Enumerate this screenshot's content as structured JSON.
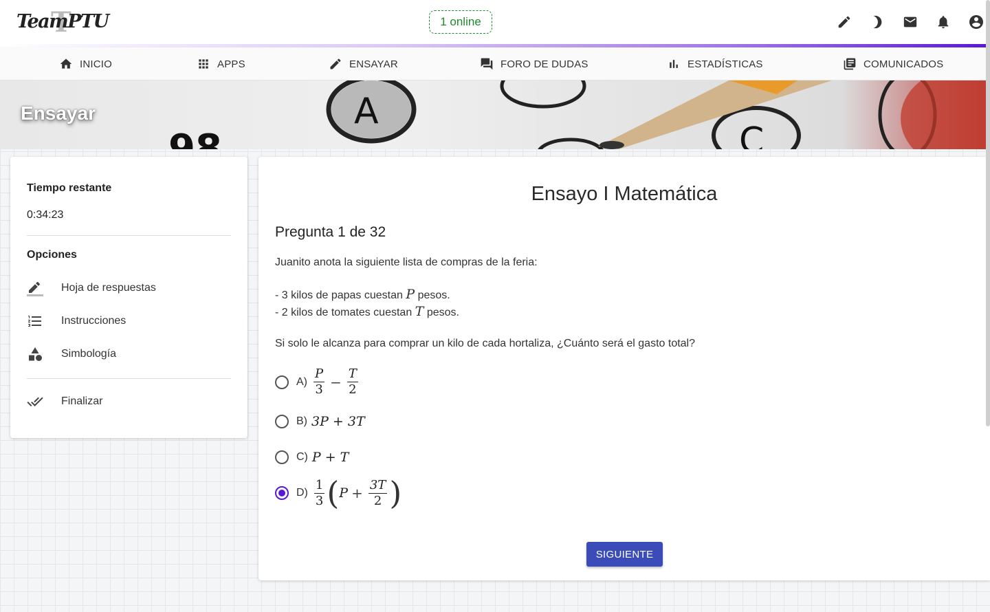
{
  "header": {
    "logo_text": "TeamPTU",
    "online_label": "1 online",
    "icons": [
      "pencil-icon",
      "moon-icon",
      "mail-icon",
      "bell-icon",
      "account-icon"
    ]
  },
  "nav": {
    "items": [
      {
        "label": "INICIO",
        "icon": "home-icon"
      },
      {
        "label": "APPS",
        "icon": "apps-grid-icon"
      },
      {
        "label": "ENSAYAR",
        "icon": "pencil-icon"
      },
      {
        "label": "FORO DE DUDAS",
        "icon": "forum-icon"
      },
      {
        "label": "ESTADÍSTICAS",
        "icon": "bar-chart-icon"
      },
      {
        "label": "COMUNICADOS",
        "icon": "library-icon"
      }
    ]
  },
  "banner": {
    "title": "Ensayar"
  },
  "sidebar": {
    "time_label": "Tiempo restante",
    "time_value": "0:34:23",
    "options_label": "Opciones",
    "items": [
      {
        "label": "Hoja de respuestas",
        "icon": "edit-sheet-icon"
      },
      {
        "label": "Instrucciones",
        "icon": "numbered-list-icon"
      },
      {
        "label": "Simbología",
        "icon": "shapes-icon"
      }
    ],
    "finish_label": "Finalizar",
    "finish_icon": "double-check-icon"
  },
  "exam": {
    "title": "Ensayo I Matemática",
    "question_heading": "Pregunta 1 de 32",
    "intro": "Juanito anota la siguiente lista de compras de la feria:",
    "line1_prefix": "- 3 kilos de papas cuestan",
    "line1_var": "P",
    "line1_suffix": "pesos.",
    "line2_prefix": "- 2 kilos de tomates cuestan",
    "line2_var": "T",
    "line2_suffix": "pesos.",
    "question": "Si solo le alcanza para comprar un kilo de cada hortaliza, ¿Cuánto será el gasto total?",
    "options": [
      {
        "letter": "A)",
        "num1": "P",
        "den1": "3",
        "op": "−",
        "num2": "T",
        "den2": "2",
        "selected": false
      },
      {
        "letter": "B)",
        "expr": "3P + 3T",
        "selected": false
      },
      {
        "letter": "C)",
        "expr": "P + T",
        "selected": false
      },
      {
        "letter": "D)",
        "num1": "1",
        "den1": "3",
        "inner_var": "P",
        "op": "+",
        "num2": "3T",
        "den2": "2",
        "selected": true
      }
    ],
    "next_label": "SIGUIENTE"
  },
  "colors": {
    "accent": "#5a18d6",
    "button": "#3b4bb8",
    "online": "#1e8a2e"
  }
}
